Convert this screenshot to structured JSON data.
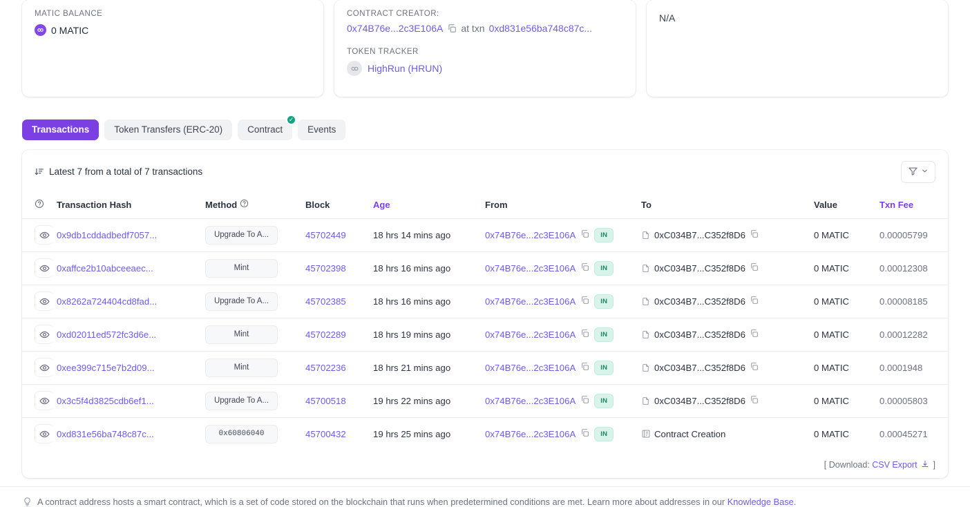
{
  "cards": {
    "balance": {
      "label": "MATIC BALANCE",
      "value": "0 MATIC",
      "coin_icon": "matic-coin-icon"
    },
    "creator": {
      "label": "CONTRACT CREATOR:",
      "address": "0x74B76e...2c3E106A",
      "at_txn_text": "at txn",
      "txn_hash": "0xd831e56ba748c87c...",
      "token_tracker_label": "TOKEN TRACKER",
      "token_name": "HighRun (HRUN)",
      "token_icon": "token-coin-icon"
    },
    "third": {
      "value": "N/A"
    }
  },
  "tabs": [
    {
      "label": "Transactions",
      "active": true,
      "badge": false
    },
    {
      "label": "Token Transfers (ERC-20)",
      "active": false,
      "badge": false
    },
    {
      "label": "Contract",
      "active": false,
      "badge": true,
      "badge_glyph": "✓"
    },
    {
      "label": "Events",
      "active": false,
      "badge": false
    }
  ],
  "table": {
    "summary": "Latest 7 from a total of 7 transactions",
    "filter_icon": "filter-icon",
    "columns": [
      {
        "key": "eye",
        "label": "",
        "help": true,
        "sorted": false
      },
      {
        "key": "hash",
        "label": "Transaction Hash",
        "help": false,
        "sorted": false
      },
      {
        "key": "method",
        "label": "Method",
        "help": true,
        "sorted": false
      },
      {
        "key": "block",
        "label": "Block",
        "help": false,
        "sorted": false
      },
      {
        "key": "age",
        "label": "Age",
        "help": false,
        "sorted": true
      },
      {
        "key": "from",
        "label": "From",
        "help": false,
        "sorted": false
      },
      {
        "key": "to",
        "label": "To",
        "help": false,
        "sorted": false
      },
      {
        "key": "value",
        "label": "Value",
        "help": false,
        "sorted": false
      },
      {
        "key": "fee",
        "label": "Txn Fee",
        "help": false,
        "sorted": true
      }
    ],
    "rows": [
      {
        "hash": "0x9db1cddadbedf7057...",
        "method": "Upgrade To A...",
        "method_mono": false,
        "block": "45702449",
        "age": "18 hrs 14 mins ago",
        "from": "0x74B76e...2c3E106A",
        "direction": "IN",
        "to": "0xC034B7...C352f8D6",
        "to_is_creation": false,
        "value": "0 MATIC",
        "fee": "0.00005799"
      },
      {
        "hash": "0xaffce2b10abceeaec...",
        "method": "Mint",
        "method_mono": false,
        "block": "45702398",
        "age": "18 hrs 16 mins ago",
        "from": "0x74B76e...2c3E106A",
        "direction": "IN",
        "to": "0xC034B7...C352f8D6",
        "to_is_creation": false,
        "value": "0 MATIC",
        "fee": "0.00012308"
      },
      {
        "hash": "0x8262a724404cd8fad...",
        "method": "Upgrade To A...",
        "method_mono": false,
        "block": "45702385",
        "age": "18 hrs 16 mins ago",
        "from": "0x74B76e...2c3E106A",
        "direction": "IN",
        "to": "0xC034B7...C352f8D6",
        "to_is_creation": false,
        "value": "0 MATIC",
        "fee": "0.00008185"
      },
      {
        "hash": "0xd02011ed572fc3d6e...",
        "method": "Mint",
        "method_mono": false,
        "block": "45702289",
        "age": "18 hrs 19 mins ago",
        "from": "0x74B76e...2c3E106A",
        "direction": "IN",
        "to": "0xC034B7...C352f8D6",
        "to_is_creation": false,
        "value": "0 MATIC",
        "fee": "0.00012282"
      },
      {
        "hash": "0xee399c715e7b2d09...",
        "method": "Mint",
        "method_mono": false,
        "block": "45702236",
        "age": "18 hrs 21 mins ago",
        "from": "0x74B76e...2c3E106A",
        "direction": "IN",
        "to": "0xC034B7...C352f8D6",
        "to_is_creation": false,
        "value": "0 MATIC",
        "fee": "0.0001948"
      },
      {
        "hash": "0x3c5f4d3825cdb6ef1...",
        "method": "Upgrade To A...",
        "method_mono": false,
        "block": "45700518",
        "age": "19 hrs 22 mins ago",
        "from": "0x74B76e...2c3E106A",
        "direction": "IN",
        "to": "0xC034B7...C352f8D6",
        "to_is_creation": false,
        "value": "0 MATIC",
        "fee": "0.00005803"
      },
      {
        "hash": "0xd831e56ba748c87c...",
        "method": "0x60806040",
        "method_mono": true,
        "block": "45700432",
        "age": "19 hrs 25 mins ago",
        "from": "0x74B76e...2c3E106A",
        "direction": "IN",
        "to": "Contract Creation",
        "to_is_creation": true,
        "value": "0 MATIC",
        "fee": "0.00045271"
      }
    ],
    "footer": {
      "prefix": "[ Download: ",
      "link": "CSV Export",
      "suffix": " ]"
    }
  },
  "disclaimer": {
    "text": "A contract address hosts a smart contract, which is a set of code stored on the blockchain that runs when predetermined conditions are met. Learn more about addresses in our ",
    "link": "Knowledge Base",
    "tail": "."
  },
  "colors": {
    "accent": "#7b3fe4",
    "link": "#6c5ce7",
    "matic": "#8247e5",
    "badge_green": "#10a37f",
    "in_bg": "#d8f3ea",
    "in_text": "#17876c"
  }
}
